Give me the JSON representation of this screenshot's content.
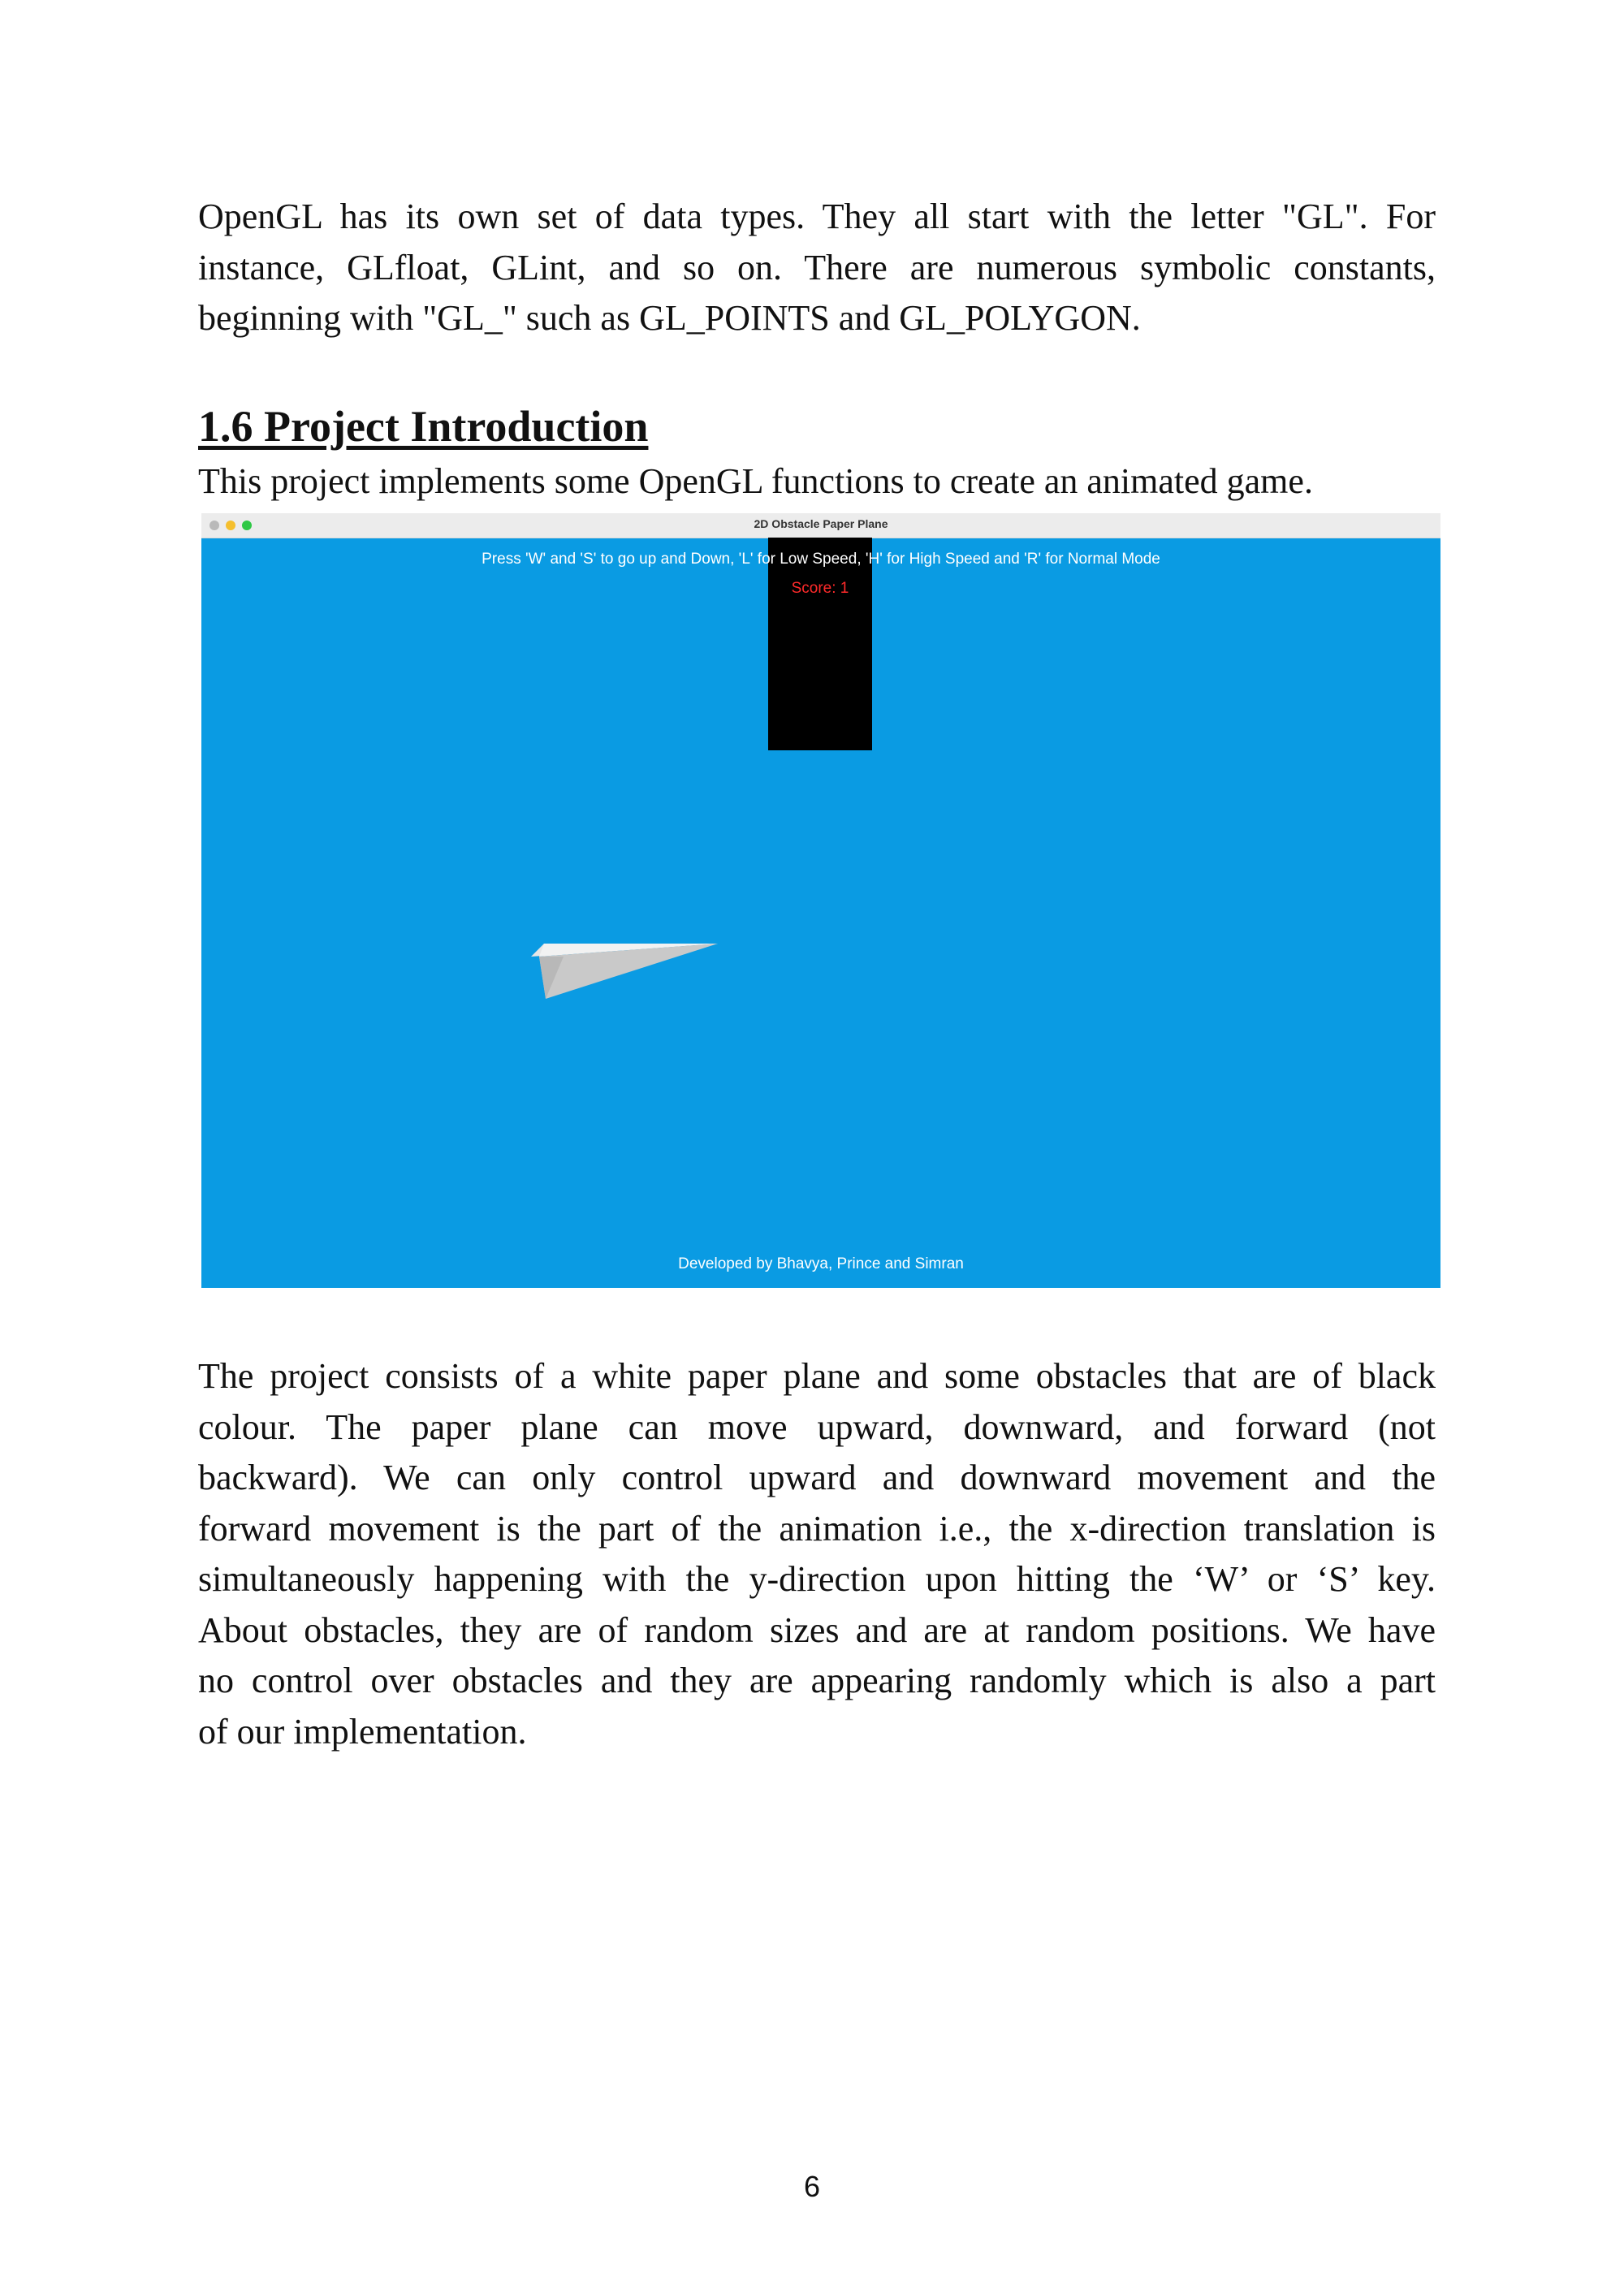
{
  "intro_paragraph": {
    "lines": [
      "OpenGL has its own set of data types. They all start with the letter \"GL\". For",
      "instance, GLfloat, GLint, and so on. There are numerous symbolic constants,",
      "beginning with \"GL_\" such as GL_POINTS and GL_POLYGON."
    ]
  },
  "section": {
    "heading": "1.6 Project Introduction",
    "intro": "This project implements some OpenGL functions to create an animated game."
  },
  "screenshot": {
    "window_title": "2D Obstacle Paper Plane",
    "instructions": "Press 'W' and 'S' to go up and Down, 'L' for Low Speed, 'H' for High Speed and 'R' for Normal Mode",
    "score": "Score: 1",
    "credits": "Developed by Bhavya, Prince and Simran",
    "colors": {
      "sky": "#0a9be3",
      "obstacle": "#000000",
      "score": "#ff2a2a",
      "plane": "#cfcfcf"
    },
    "icons": [
      "window-close-icon",
      "window-minimize-icon",
      "window-maximize-icon",
      "paper-plane-icon"
    ]
  },
  "body_paragraph": {
    "lines": [
      "The project consists of a white paper plane and some obstacles that are of black",
      "colour. The paper plane can move upward, downward, and forward (not",
      "backward). We can only control upward and downward movement and the",
      "forward movement is the part of the animation i.e., the x-direction translation is",
      "simultaneously happening with the y-direction upon hitting the ‘W’ or ‘S’ key.",
      "About obstacles, they are of random sizes and are at random positions. We have",
      "no control over obstacles and they are appearing randomly which is also a part",
      "of our implementation."
    ]
  },
  "page_number": "6"
}
